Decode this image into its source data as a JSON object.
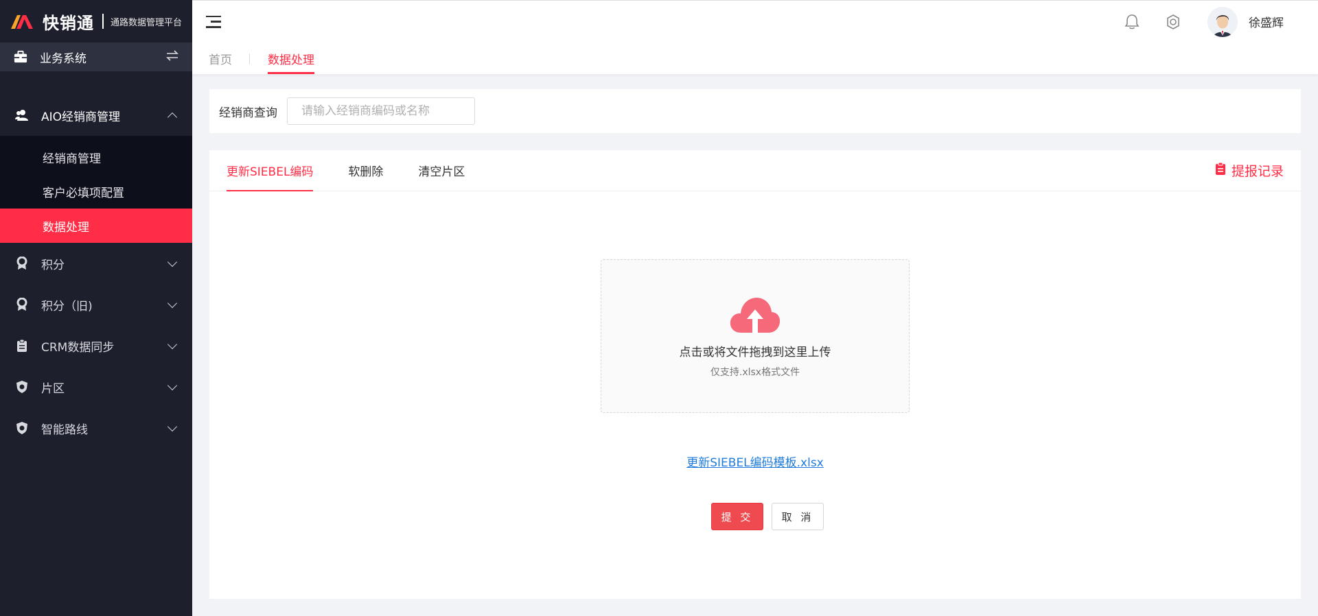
{
  "app": {
    "brand": "快销通",
    "subtitle": "通路数据管理平台",
    "brand_colors": [
      "#ff2d45",
      "#f7a52b"
    ]
  },
  "sidebar": {
    "system": {
      "label": "业务系统",
      "icon": "briefcase-icon",
      "action_icon": "swap-icon"
    },
    "groups": [
      {
        "label": "AIO经销商管理",
        "icon": "user-group-icon",
        "expanded": true,
        "children": [
          {
            "label": "经销商管理",
            "active": false
          },
          {
            "label": "客户必填项配置",
            "active": false
          },
          {
            "label": "数据处理",
            "active": true
          }
        ]
      },
      {
        "label": "积分",
        "icon": "medal-icon",
        "expanded": false
      },
      {
        "label": "积分（旧)",
        "icon": "medal-icon",
        "expanded": false
      },
      {
        "label": "CRM数据同步",
        "icon": "clipboard-icon",
        "expanded": false
      },
      {
        "label": "片区",
        "icon": "shield-icon",
        "expanded": false
      },
      {
        "label": "智能路线",
        "icon": "shield-icon",
        "expanded": false
      }
    ]
  },
  "header": {
    "username": "徐盛辉",
    "icons": [
      "bell-icon",
      "settings-icon"
    ]
  },
  "tabs": {
    "home": "首页",
    "current": "数据处理"
  },
  "search": {
    "label": "经销商查询",
    "placeholder": "请输入经销商编码或名称",
    "value": ""
  },
  "main": {
    "tabs": [
      {
        "label": "更新SIEBEL编码",
        "active": true
      },
      {
        "label": "软删除",
        "active": false
      },
      {
        "label": "清空片区",
        "active": false
      }
    ],
    "report_link": "提报记录",
    "upload": {
      "title": "点击或将文件拖拽到这里上传",
      "hint": "仅支持.xlsx格式文件"
    },
    "template_link": "更新SIEBEL编码模板.xlsx",
    "submit_label": "提 交",
    "cancel_label": "取 消"
  },
  "colors": {
    "accent": "#ff2d45",
    "sidebar_bg": "#1d1f2d",
    "submenu_bg": "#0d0f1a",
    "link": "#1e7bdc"
  }
}
